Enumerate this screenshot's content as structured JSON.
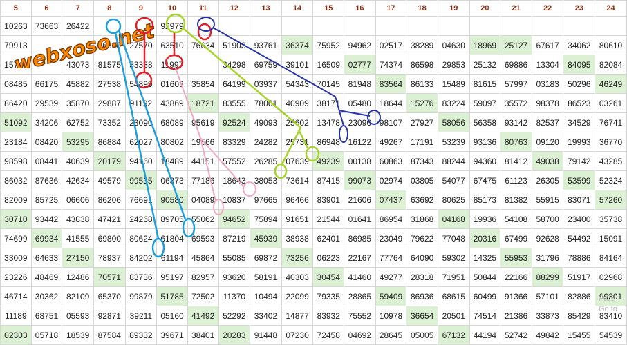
{
  "columns": [
    "5",
    "6",
    "7",
    "8",
    "9",
    "10",
    "11",
    "12",
    "13",
    "14",
    "15",
    "16",
    "17",
    "18",
    "19",
    "20",
    "21",
    "22",
    "23",
    "24"
  ],
  "rows": [
    [
      "10263",
      "73663",
      "26422",
      "",
      "",
      "92979",
      "",
      "",
      "",
      "",
      "",
      "",
      "",
      "",
      "",
      "",
      "",
      "",
      "",
      ""
    ],
    [
      "79913",
      "",
      "",
      "56860",
      "27570",
      "63510",
      "76634",
      "51903",
      "93761",
      "36374",
      "75952",
      "94962",
      "02517",
      "38289",
      "04630",
      "18969",
      "25127",
      "67617",
      "34062",
      "80610"
    ],
    [
      "15740",
      "",
      "43073",
      "81575",
      "53388",
      "11997",
      "",
      "34298",
      "69759",
      "39101",
      "16509",
      "02777",
      "74374",
      "86598",
      "29853",
      "25132",
      "69886",
      "13304",
      "84095",
      "82084"
    ],
    [
      "08485",
      "66175",
      "45882",
      "27538",
      "54899",
      "01603",
      "35854",
      "64199",
      "03937",
      "54343",
      "70145",
      "81948",
      "83564",
      "86133",
      "15489",
      "81615",
      "57997",
      "03183",
      "50296",
      "46249"
    ],
    [
      "86420",
      "29539",
      "35870",
      "29887",
      "91192",
      "43869",
      "18721",
      "83555",
      "78061",
      "40909",
      "38171",
      "05480",
      "18644",
      "15276",
      "83224",
      "59097",
      "35572",
      "98378",
      "86523",
      "03261"
    ],
    [
      "51092",
      "34206",
      "62752",
      "73352",
      "23090",
      "68089",
      "95619",
      "92524",
      "49093",
      "25602",
      "13478",
      "23096",
      "98107",
      "27927",
      "58056",
      "56358",
      "93142",
      "82537",
      "34529",
      "76741"
    ],
    [
      "23184",
      "08420",
      "53295",
      "86884",
      "62027",
      "80802",
      "19566",
      "83329",
      "24282",
      "25731",
      "86948",
      "16122",
      "49267",
      "17191",
      "53239",
      "93136",
      "80763",
      "09120",
      "19993",
      "36770"
    ],
    [
      "98598",
      "08441",
      "40639",
      "20179",
      "94160",
      "18489",
      "44151",
      "57552",
      "26285",
      "07639",
      "49239",
      "00138",
      "60863",
      "87343",
      "88244",
      "94360",
      "81412",
      "49038",
      "79142",
      "43285"
    ],
    [
      "86032",
      "87636",
      "42634",
      "49579",
      "99535",
      "06373",
      "77186",
      "18643",
      "38053",
      "73614",
      "87415",
      "99073",
      "02974",
      "03805",
      "54077",
      "67475",
      "61123",
      "26305",
      "53599",
      "52324"
    ],
    [
      "82009",
      "85725",
      "06606",
      "86206",
      "76691",
      "90580",
      "04089",
      "10837",
      "97665",
      "96466",
      "83901",
      "21606",
      "07437",
      "63692",
      "80625",
      "85173",
      "81382",
      "55915",
      "83071",
      "57260"
    ],
    [
      "30710",
      "93442",
      "43838",
      "47421",
      "24268",
      "89705",
      "55062",
      "94652",
      "75894",
      "91651",
      "21544",
      "01641",
      "86954",
      "31868",
      "04168",
      "19936",
      "54108",
      "58700",
      "23400",
      "35738"
    ],
    [
      "74699",
      "69934",
      "41555",
      "69800",
      "80624",
      "61804",
      "69593",
      "87219",
      "45939",
      "38938",
      "62401",
      "86985",
      "23049",
      "79622",
      "77048",
      "20316",
      "67499",
      "92628",
      "54492",
      "15091"
    ],
    [
      "33009",
      "64633",
      "27150",
      "78937",
      "84202",
      "61194",
      "45864",
      "55085",
      "69872",
      "73256",
      "06223",
      "22167",
      "77764",
      "64090",
      "59302",
      "14325",
      "55953",
      "31796",
      "78886",
      "84164"
    ],
    [
      "23226",
      "48469",
      "12486",
      "70571",
      "83736",
      "95197",
      "82957",
      "93620",
      "58191",
      "40303",
      "30454",
      "41460",
      "49277",
      "28318",
      "71951",
      "50844",
      "22166",
      "88299",
      "51917",
      "02968"
    ],
    [
      "46714",
      "30362",
      "82109",
      "65370",
      "99879",
      "51785",
      "72502",
      "11370",
      "10494",
      "22099",
      "79335",
      "28865",
      "59409",
      "86936",
      "68615",
      "60499",
      "91366",
      "57101",
      "82886",
      "99301"
    ],
    [
      "11189",
      "68751",
      "05593",
      "92871",
      "39211",
      "05160",
      "41492",
      "52292",
      "33402",
      "14877",
      "83932",
      "75552",
      "10978",
      "36654",
      "20501",
      "74514",
      "21386",
      "33873",
      "85429",
      "83410"
    ],
    [
      "02303",
      "05718",
      "18539",
      "87584",
      "89332",
      "39671",
      "38401",
      "20283",
      "91448",
      "07230",
      "72458",
      "04692",
      "28645",
      "05005",
      "67132",
      "44194",
      "52742",
      "49842",
      "15455",
      "54539"
    ]
  ],
  "highlight": [
    [
      1,
      15
    ],
    [
      1,
      9
    ],
    [
      1,
      16
    ],
    [
      2,
      11
    ],
    [
      2,
      18
    ],
    [
      3,
      12
    ],
    [
      3,
      19
    ],
    [
      4,
      6
    ],
    [
      4,
      13
    ],
    [
      5,
      0
    ],
    [
      5,
      7
    ],
    [
      5,
      14
    ],
    [
      6,
      2
    ],
    [
      6,
      16
    ],
    [
      7,
      3
    ],
    [
      7,
      10
    ],
    [
      7,
      17
    ],
    [
      8,
      4
    ],
    [
      8,
      11
    ],
    [
      8,
      18
    ],
    [
      9,
      5
    ],
    [
      9,
      12
    ],
    [
      9,
      19
    ],
    [
      10,
      0
    ],
    [
      10,
      7
    ],
    [
      10,
      14
    ],
    [
      11,
      1
    ],
    [
      11,
      8
    ],
    [
      11,
      15
    ],
    [
      12,
      2
    ],
    [
      12,
      9
    ],
    [
      12,
      16
    ],
    [
      13,
      3
    ],
    [
      13,
      10
    ],
    [
      13,
      17
    ],
    [
      14,
      5
    ],
    [
      14,
      12
    ],
    [
      14,
      19
    ],
    [
      15,
      6
    ],
    [
      15,
      13
    ],
    [
      16,
      0
    ],
    [
      16,
      7
    ],
    [
      16,
      14
    ]
  ],
  "watermark": "webxoso.net",
  "activate_windows": {
    "line1": "Acti",
    "line2": "Go to"
  }
}
